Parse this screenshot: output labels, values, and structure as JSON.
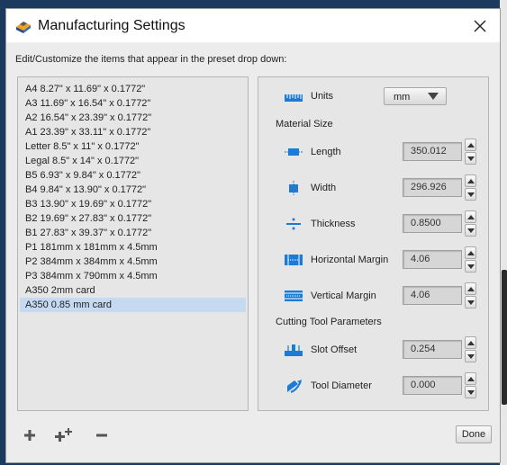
{
  "window": {
    "title": "Manufacturing Settings",
    "close_symbol": "✕"
  },
  "instruction": "Edit/Customize the items that appear in the preset drop down:",
  "presets": [
    "A4 8.27\" x 11.69\" x 0.1772\"",
    "A3 11.69\" x 16.54\" x 0.1772\"",
    "A2 16.54\" x 23.39\" x 0.1772\"",
    "A1 23.39\" x 33.11\" x 0.1772\"",
    "Letter 8.5\" x 11\" x 0.1772\"",
    "Legal 8.5\" x 14\" x 0.1772\"",
    "B5 6.93\" x 9.84\" x 0.1772\"",
    "B4 9.84\" x 13.90\" x 0.1772\"",
    "B3 13.90\" x 19.69\" x 0.1772\"",
    "B2 19.69\" x 27.83\" x 0.1772\"",
    "B1 27.83\" x 39.37\" x 0.1772\"",
    "P1 181mm x 181mm x 4.5mm",
    "P2 384mm x 384mm x 4.5mm",
    "P3 384mm x 790mm x 4.5mm",
    "A350 2mm card",
    "A350 0.85 mm card"
  ],
  "selected_preset": "A350 0.85 mm card",
  "settings": {
    "units_label": "Units",
    "units_value": "mm",
    "material_size_heading": "Material Size",
    "length_label": "Length",
    "length_value": "350.012",
    "width_label": "Width",
    "width_value": "296.926",
    "thickness_label": "Thickness",
    "thickness_value": "0.8500",
    "horizontal_margin_label": "Horizontal Margin",
    "horizontal_margin_value": "4.06",
    "vertical_margin_label": "Vertical Margin",
    "vertical_margin_value": "4.06",
    "cutting_tool_heading": "Cutting Tool Parameters",
    "slot_offset_label": "Slot Offset",
    "slot_offset_value": "0.254",
    "tool_diameter_label": "Tool Diameter",
    "tool_diameter_value": "0.000"
  },
  "footer": {
    "add_icon": "plus-icon",
    "add_copy_icon": "plus-plus-icon",
    "remove_icon": "minus-icon",
    "done_label": "Done"
  },
  "colors": {
    "icon_blue": "#1b7bd6",
    "selection": "#c5daf0"
  }
}
